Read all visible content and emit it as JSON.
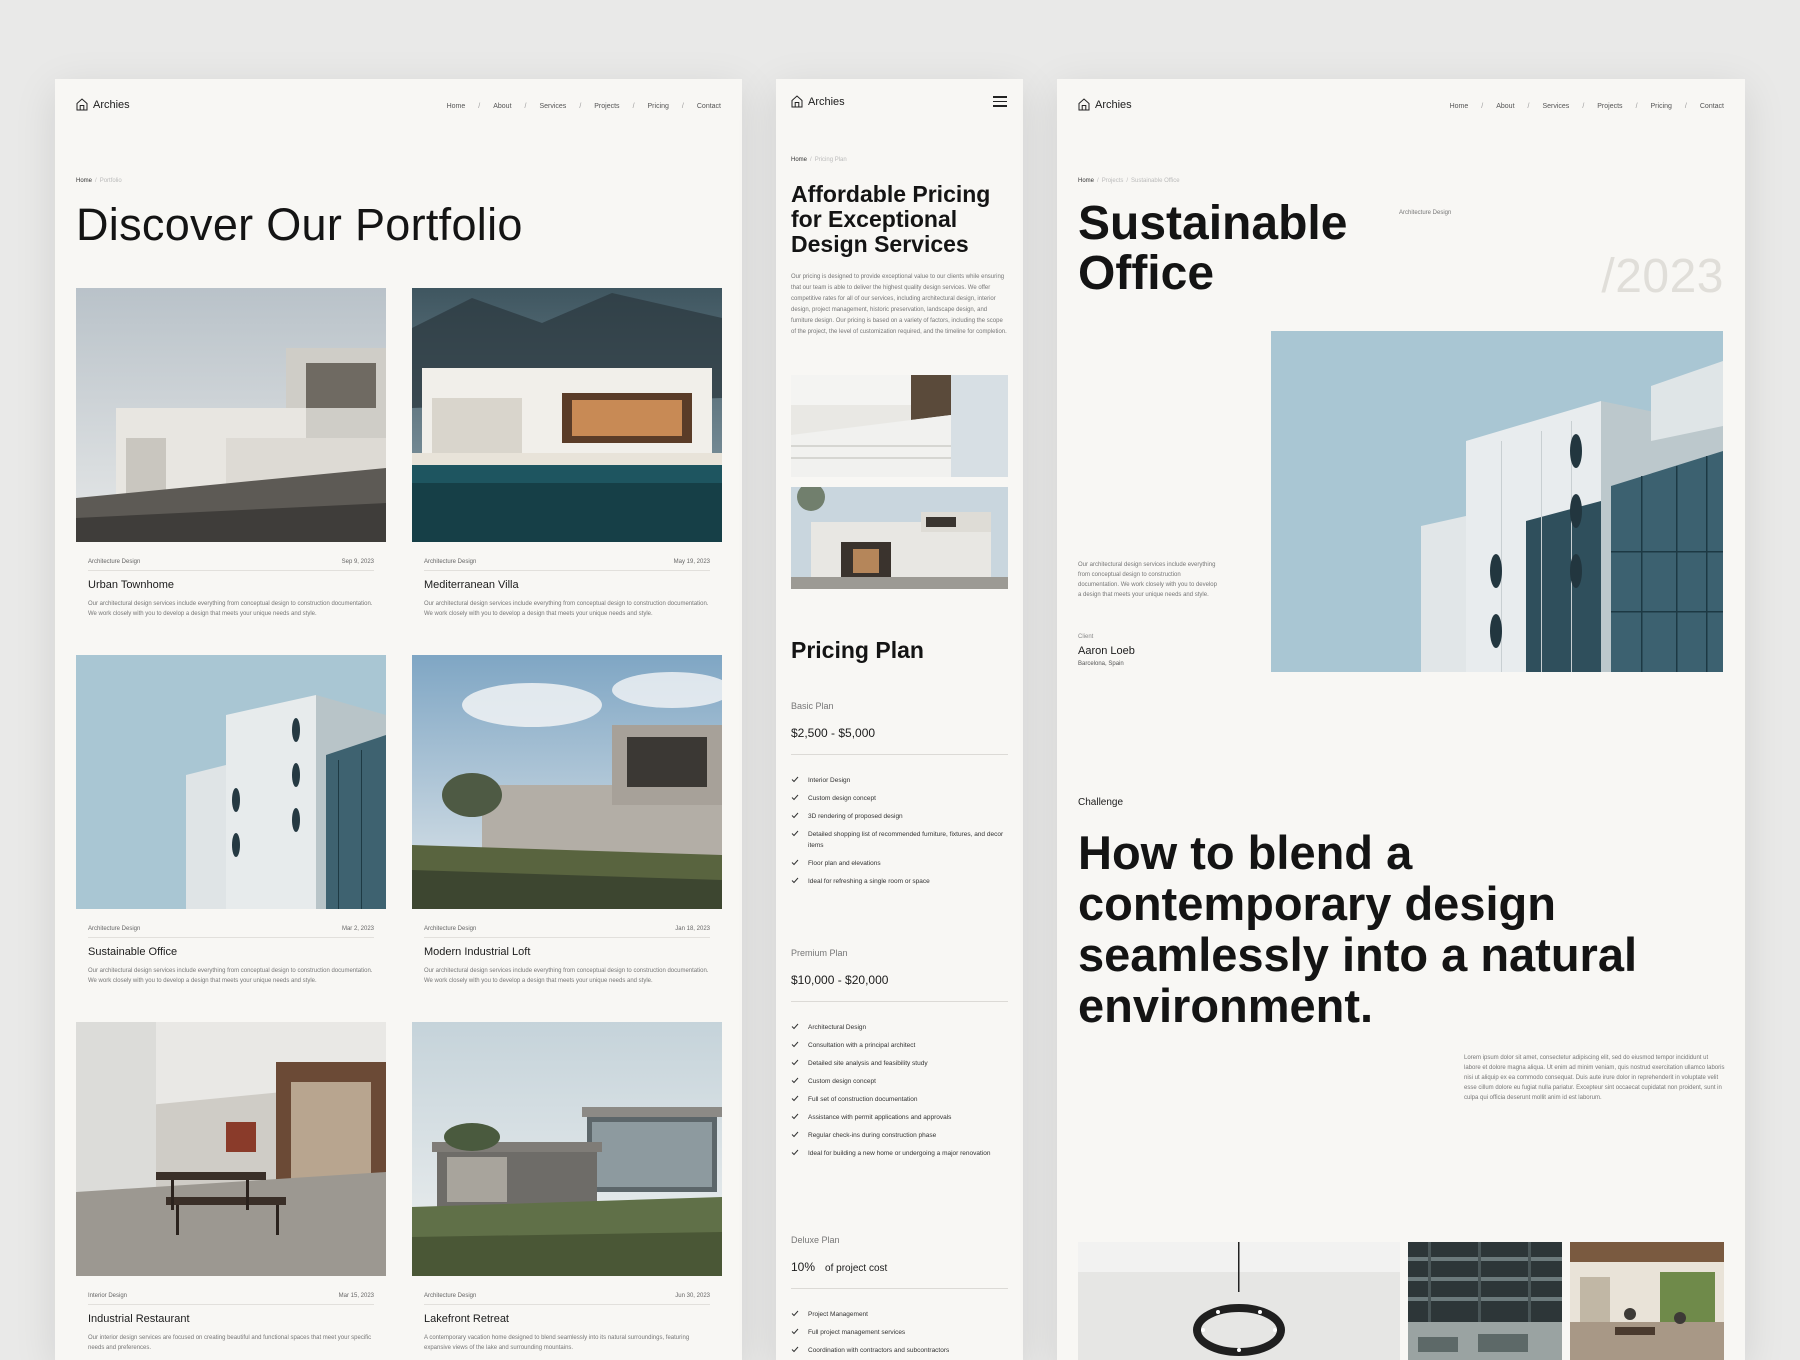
{
  "brand": {
    "name": "Archies"
  },
  "nav": {
    "items": [
      "Home",
      "About",
      "Services",
      "Projects",
      "Pricing",
      "Contact"
    ],
    "separator": "/"
  },
  "portfolio": {
    "breadcrumb": {
      "home": "Home",
      "separator": "/",
      "current": "Portfolio"
    },
    "title": "Discover Our Portfolio",
    "cards": [
      {
        "category": "Architecture Design",
        "date": "Sep 9, 2023",
        "title": "Urban Townhome",
        "desc": "Our architectural design services include everything from conceptual design to construction documentation. We work closely with you to develop a design that meets your unique needs and style.",
        "image": "minimal-house-photo"
      },
      {
        "category": "Architecture Design",
        "date": "May 19, 2023",
        "title": "Mediterranean Villa",
        "desc": "Our architectural design services include everything from conceptual design to construction documentation. We work closely with you to develop a design that meets your unique needs and style.",
        "image": "villa-pool-photo"
      },
      {
        "category": "Architecture Design",
        "date": "Mar 2, 2023",
        "title": "Sustainable Office",
        "desc": "Our architectural design services include everything from conceptual design to construction documentation. We work closely with you to develop a design that meets your unique needs and style.",
        "image": "office-tower-photo"
      },
      {
        "category": "Architecture Design",
        "date": "Jan 18, 2023",
        "title": "Modern Industrial Loft",
        "desc": "Our architectural design services include everything from conceptual design to construction documentation. We work closely with you to develop a design that meets your unique needs and style.",
        "image": "loft-house-photo"
      },
      {
        "category": "Interior Design",
        "date": "Mar 15, 2023",
        "title": "Industrial Restaurant",
        "desc": "Our interior design services are focused on creating beautiful and functional spaces that meet your specific needs and preferences.",
        "image": "restaurant-interior-photo"
      },
      {
        "category": "Architecture Design",
        "date": "Jun 30, 2023",
        "title": "Lakefront Retreat",
        "desc": "A contemporary vacation home designed to blend seamlessly into its natural surroundings, featuring expansive views of the lake and surrounding mountains.",
        "image": "lakefront-house-photo"
      }
    ]
  },
  "pricing": {
    "breadcrumb": {
      "home": "Home",
      "separator": "/",
      "current": "Pricing Plan"
    },
    "title": "Affordable Pricing for Exceptional Design Services",
    "intro": "Our pricing is designed to provide exceptional value to our clients while ensuring that our team is able to deliver the highest quality design services. We offer competitive rates for all of our services, including architectural design, interior design, project management, historic preservation, landscape design, and furniture design. Our pricing is based on a variety of factors, including the scope of the project, the level of customization required, and the timeline for completion.",
    "section_title": "Pricing Plan",
    "plans": [
      {
        "name": "Basic Plan",
        "price": "$2,500 - $5,000",
        "features": [
          "Interior Design",
          "Custom design concept",
          "3D rendering of proposed design",
          "Detailed shopping list of recommended furniture, fixtures, and decor items",
          "Floor plan and elevations",
          "Ideal for refreshing a single room or space"
        ]
      },
      {
        "name": "Premium Plan",
        "price": "$10,000 - $20,000",
        "features": [
          "Architectural Design",
          "Consultation with a principal architect",
          "Detailed site analysis and feasibility study",
          "Custom design concept",
          "Full set of construction documentation",
          "Assistance with permit applications and approvals",
          "Regular check-ins during construction phase",
          "Ideal for building a new home or undergoing a major renovation"
        ]
      },
      {
        "name": "Deluxe Plan",
        "price_pct": "10%",
        "price_rest": "of project cost",
        "features": [
          "Project Management",
          "Full project management services",
          "Coordination with contractors and subcontractors"
        ]
      }
    ]
  },
  "project": {
    "breadcrumb": {
      "home": "Home",
      "sep": "/",
      "mid": "Projects",
      "current": "Sustainable Office"
    },
    "title": "Sustainable Office",
    "category": "Architecture Design",
    "year": "/2023",
    "summary": "Our architectural design services include everything from conceptual design to construction documentation. We work closely with you to develop a design that meets your unique needs and style.",
    "client_label": "Client",
    "client_name": "Aaron Loeb",
    "client_location": "Barcelona, Spain",
    "challenge_label": "Challenge",
    "challenge_title": "How to blend a contemporary design seamlessly into a natural environment.",
    "body": "Lorem ipsum dolor sit amet, consectetur adipiscing elit, sed do eiusmod tempor incididunt ut labore et dolore magna aliqua. Ut enim ad minim veniam, quis nostrud exercitation ullamco laboris nisi ut aliquip ex ea commodo consequat. Duis aute irure dolor in reprehenderit in voluptate velit esse cillum dolore eu fugiat nulla pariatur. Excepteur sint occaecat cupidatat non proident, sunt in culpa qui officia deserunt mollit anim id est laborum."
  },
  "colors": {
    "page_bg": "#e9e9e8",
    "panel_bg": "#f8f7f4",
    "text": "#1c1c1c",
    "muted": "#777777",
    "year_muted": "#e0ded9"
  }
}
